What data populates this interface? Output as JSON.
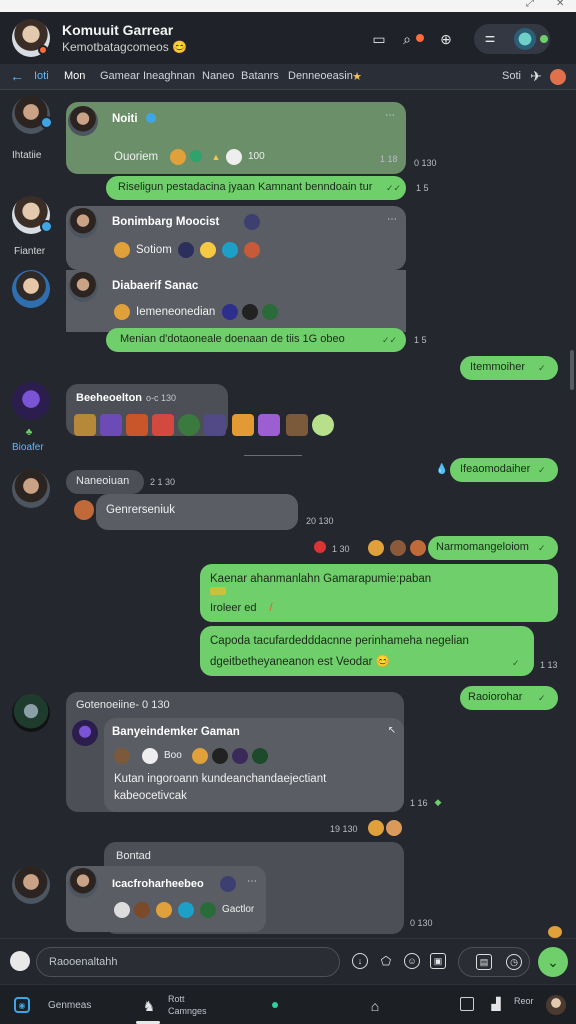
{
  "header": {
    "title": "Komuuit Garrear",
    "subtitle": "Kemotbatagcomeos 😊"
  },
  "tabs": [
    {
      "label": "Ioti"
    },
    {
      "label": "Mon"
    },
    {
      "label": "Gamear"
    },
    {
      "label": "Ineaghnan"
    },
    {
      "label": "Naneo"
    },
    {
      "label": "Batanrs"
    },
    {
      "label": "Denneoeasin"
    },
    {
      "label": "Soti"
    }
  ],
  "sidebar_labels": {
    "user1": "Ihtatiie",
    "user2": "Fianter",
    "user3": "Bioafer"
  },
  "messages": {
    "m1": {
      "name": "Noiti",
      "text": "Ouoriem",
      "meta": "100",
      "time1": "1 18",
      "time2": "0 130"
    },
    "m2": {
      "text": "Riseligun pestadacina jyaan Kamnant benndoain tur",
      "time": "1 5"
    },
    "m3": {
      "name": "Bonimbarg Moocist",
      "meta": "...",
      "text": "Sotiom"
    },
    "m4": {
      "name": "Diabaerif Sanac",
      "text": "Iemeneonedian"
    },
    "m5": {
      "text": "Menian d'dotaoneale doenaan de tiis 1G obeo",
      "time": "1 5"
    },
    "m6": {
      "text": "Itemmoiher"
    },
    "m7": {
      "name": "Beeheoelton",
      "meta": "o-c 130",
      "time": ""
    },
    "m8": {
      "text": "Ifeaomodaiher"
    },
    "m9": {
      "name": "Naneoiuan",
      "meta": "2 1 30",
      "text": "Genrerseniuk",
      "time": "20 130"
    },
    "m10": {
      "time": "1 30",
      "text": "Narmomangeloiom"
    },
    "m11": {
      "line1": "Kaenar ahanmanlahn Gamarapumie:paban",
      "line2": "Iroleer ed"
    },
    "m12": {
      "line1": "Capoda tacufardedddacnne perinhameha negelian",
      "line2": "dgeitbetheyaneanon est Veodar 😊",
      "time": "1 13"
    },
    "m13": {
      "text": "Raoiorohar"
    },
    "m14": {
      "header": "Gotenoeiine- 0 130",
      "name": "Banyeindemker Gaman",
      "tag": "Boo",
      "line1": "Kutan ingoroann kundeanchandaejectiant",
      "line2": "kabeocetivcak",
      "time1": "1 16",
      "time2": "19 130"
    },
    "m15": {
      "caption": "Bontad",
      "name": "Icacfroharheebeo",
      "text": "Gactlor",
      "time": "0 130"
    }
  },
  "composer": {
    "placeholder": "Raooenaltahh"
  },
  "bottom_nav": {
    "games": "Genmeas",
    "camgas_top": "Rott",
    "camgas_bottom": "Camnges",
    "extra": "Reor"
  },
  "colors": {
    "accent": "#5cb8ff",
    "outgoing": "#6fcf6a",
    "incoming": "#5a5d64",
    "background": "#24272e"
  }
}
